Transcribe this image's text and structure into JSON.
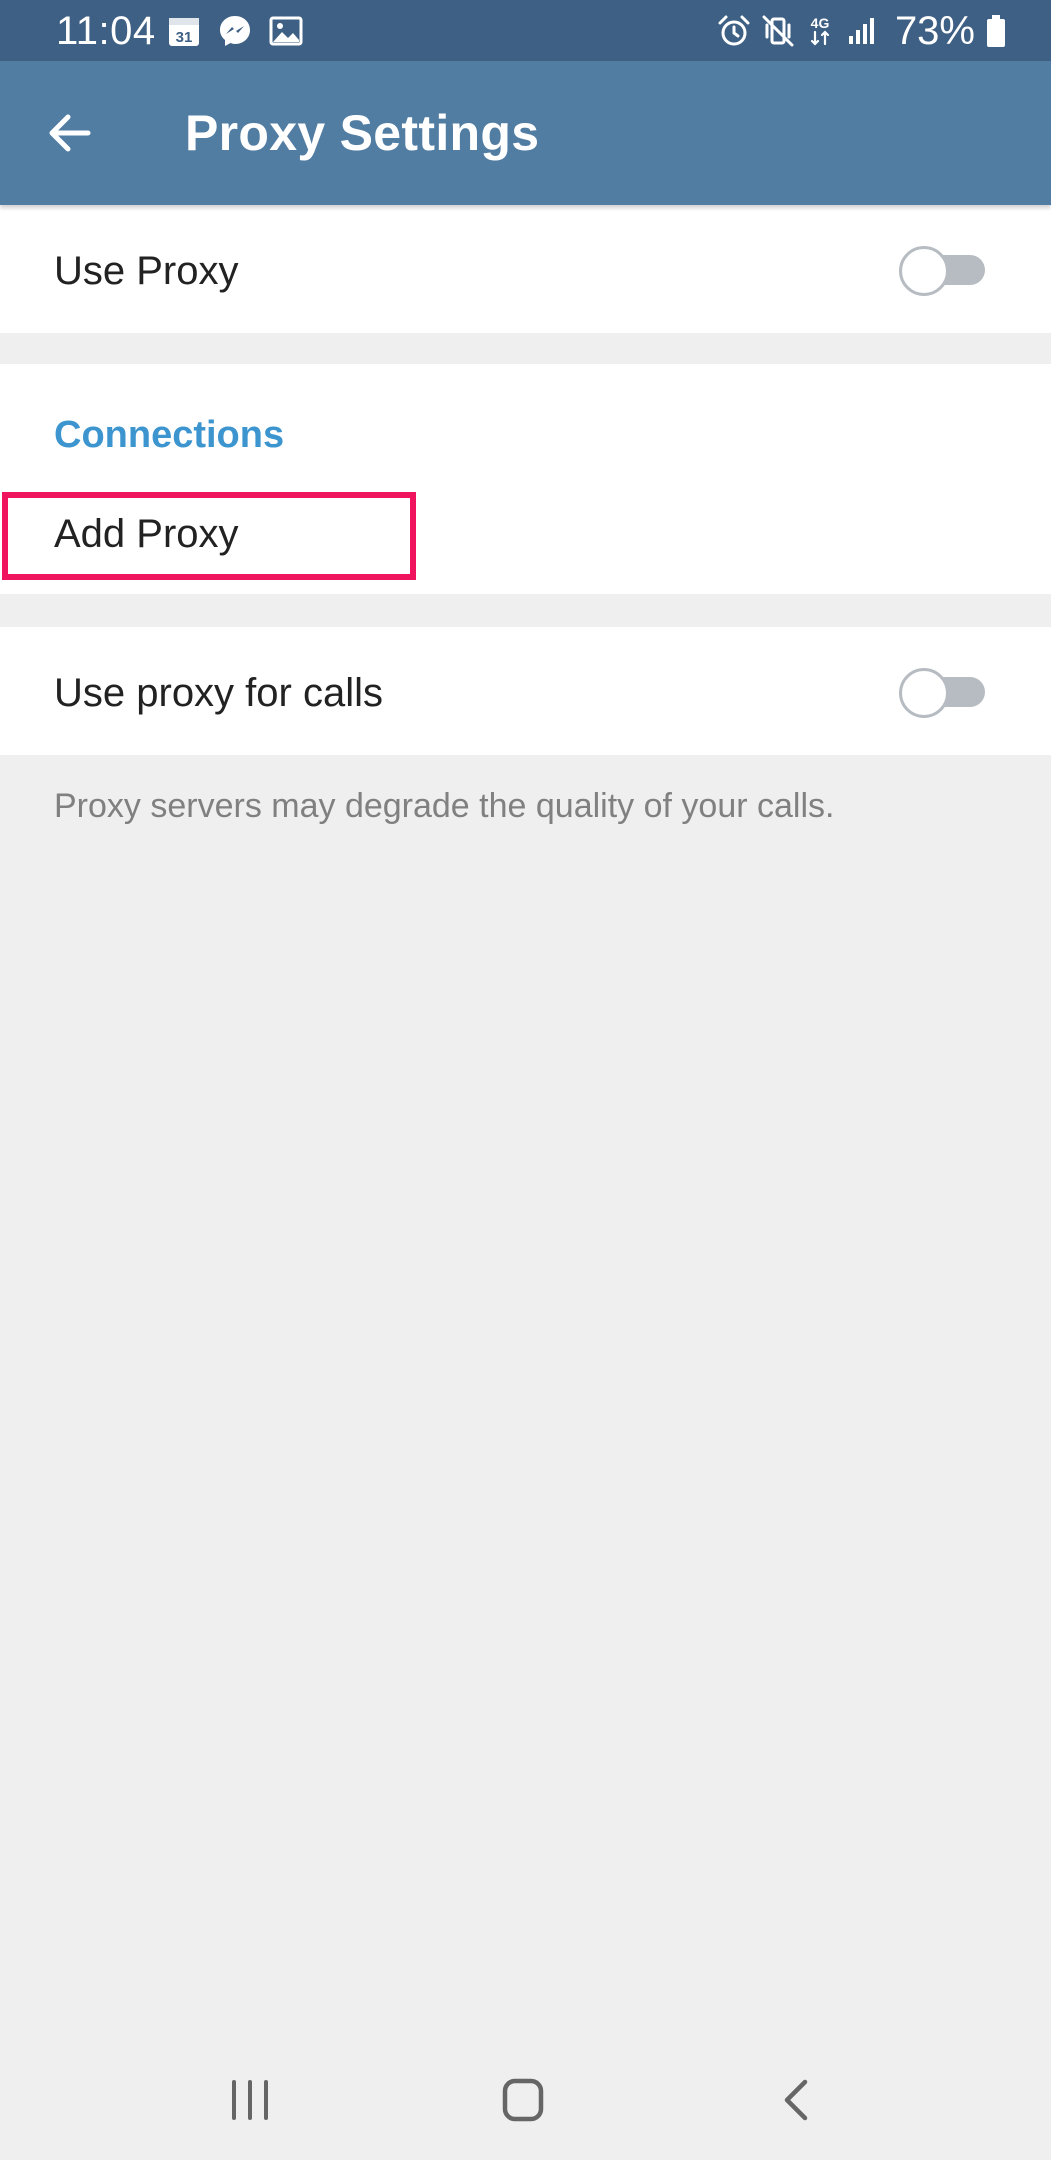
{
  "status_bar": {
    "time": "11:04",
    "calendar_day": "31",
    "battery": "73%",
    "network": "4G",
    "left_icons": [
      "calendar-icon",
      "messenger-icon",
      "gallery-icon"
    ],
    "right_icons": [
      "alarm-icon",
      "vibrate-icon",
      "network-4g-icon",
      "signal-icon",
      "battery-icon"
    ]
  },
  "toolbar": {
    "title": "Proxy Settings",
    "back_icon": "arrow-left-icon"
  },
  "use_proxy": {
    "label": "Use Proxy",
    "enabled": false
  },
  "connections": {
    "header": "Connections",
    "add_proxy_label": "Add Proxy",
    "highlight_color": "#f0135d"
  },
  "calls_proxy": {
    "label": "Use proxy for calls",
    "enabled": false,
    "info": "Proxy servers may degrade the quality of your calls."
  },
  "nav_bar": {
    "buttons": [
      "recent-apps-icon",
      "home-icon",
      "back-icon"
    ]
  },
  "colors": {
    "status_bar": "#3e6084",
    "toolbar": "#527da3",
    "accent": "#3d95cf",
    "background": "#efefef",
    "toggle_off": "#b6bcc1"
  }
}
